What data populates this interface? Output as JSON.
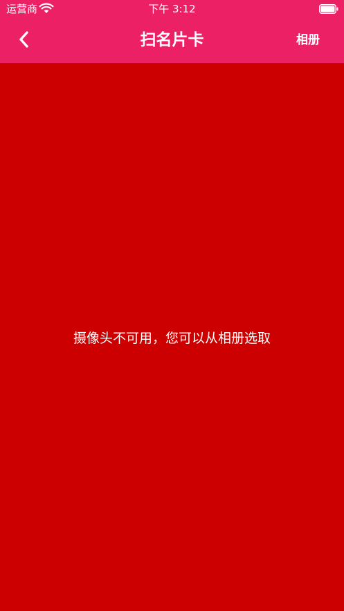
{
  "status_bar": {
    "carrier": "运营商",
    "time": "下午 3:12"
  },
  "nav": {
    "back_icon": "chevron-left-icon",
    "title": "扫名片卡",
    "album_label": "相册"
  },
  "content": {
    "message": "摄像头不可用，您可以从相册选取"
  },
  "colors": {
    "header_bg": "#ec2165",
    "content_bg": "#cc0000",
    "text": "#ffffff"
  }
}
